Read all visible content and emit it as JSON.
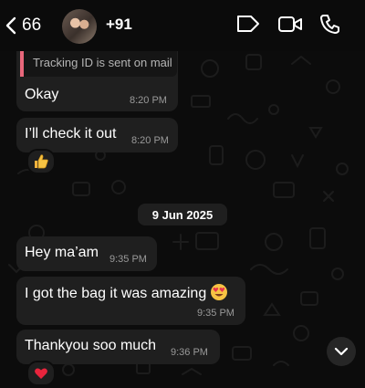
{
  "header": {
    "back_count": "66",
    "contact_name": "+91",
    "icons": [
      "chevron-left-icon",
      "tag-icon",
      "video-camera-icon",
      "phone-icon"
    ]
  },
  "messages": [
    {
      "reply_quote": "Tracking ID is sent on mail",
      "text": "Okay",
      "time": "8:20 PM"
    },
    {
      "text": "I’ll check it out",
      "time": "8:20 PM",
      "reaction": "thumbs-up"
    },
    {
      "date": "9 Jun 2025"
    },
    {
      "text": "Hey ma’am",
      "time": "9:35 PM"
    },
    {
      "text": "I got the bag it was amazing",
      "time": "9:35 PM",
      "inline_emoji": "heart-eyes"
    },
    {
      "text": "Thankyou soo much",
      "time": "9:36 PM",
      "reaction": "red-heart"
    }
  ],
  "colors": {
    "background": "#0c0c0c",
    "bubble": "#1f1f1f",
    "quote_bar": "#e8677b",
    "time_text": "#9a9a9a"
  }
}
